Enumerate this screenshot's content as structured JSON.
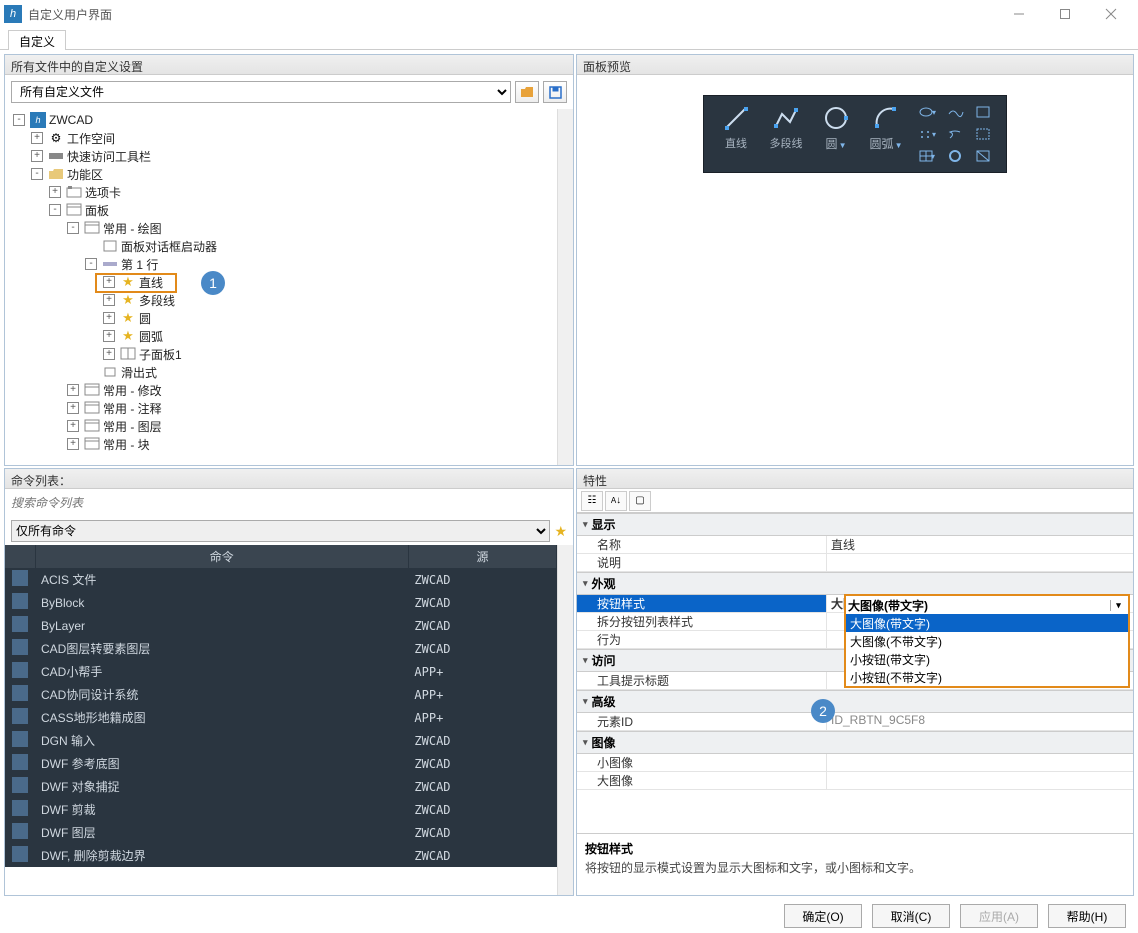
{
  "window": {
    "title": "自定义用户界面"
  },
  "tab": {
    "label": "自定义"
  },
  "panels": {
    "customize": {
      "header": "所有文件中的自定义设置",
      "filter_selected": "所有自定义文件"
    },
    "preview": {
      "header": "面板预览"
    },
    "commands": {
      "header": "命令列表：",
      "search_placeholder": "搜索命令列表",
      "filter_selected": "仅所有命令",
      "col_cmd": "命令",
      "col_src": "源"
    },
    "properties": {
      "header": "特性"
    }
  },
  "tree": [
    {
      "lvl": 0,
      "exp": "-",
      "icon": "app",
      "label": "ZWCAD"
    },
    {
      "lvl": 1,
      "exp": "+",
      "icon": "gear",
      "label": "工作空间"
    },
    {
      "lvl": 1,
      "exp": "+",
      "icon": "toolbar",
      "label": "快速访问工具栏"
    },
    {
      "lvl": 1,
      "exp": "-",
      "icon": "folder",
      "label": "功能区"
    },
    {
      "lvl": 2,
      "exp": "+",
      "icon": "tabs",
      "label": "选项卡"
    },
    {
      "lvl": 2,
      "exp": "-",
      "icon": "panel",
      "label": "面板"
    },
    {
      "lvl": 3,
      "exp": "-",
      "icon": "panel",
      "label": "常用 - 绘图"
    },
    {
      "lvl": 4,
      "exp": " ",
      "icon": "dialog",
      "label": "面板对话框启动器"
    },
    {
      "lvl": 4,
      "exp": "-",
      "icon": "row",
      "label": "第 1 行"
    },
    {
      "lvl": 5,
      "exp": "+",
      "icon": "star",
      "label": "直线",
      "hl": true
    },
    {
      "lvl": 5,
      "exp": "+",
      "icon": "star",
      "label": "多段线"
    },
    {
      "lvl": 5,
      "exp": "+",
      "icon": "star",
      "label": "圆"
    },
    {
      "lvl": 5,
      "exp": "+",
      "icon": "star",
      "label": "圆弧"
    },
    {
      "lvl": 5,
      "exp": "+",
      "icon": "sub",
      "label": "子面板1"
    },
    {
      "lvl": 4,
      "exp": " ",
      "icon": "slide",
      "label": "滑出式"
    },
    {
      "lvl": 3,
      "exp": "+",
      "icon": "panel",
      "label": "常用 - 修改"
    },
    {
      "lvl": 3,
      "exp": "+",
      "icon": "panel",
      "label": "常用 - 注释"
    },
    {
      "lvl": 3,
      "exp": "+",
      "icon": "panel",
      "label": "常用 - 图层"
    },
    {
      "lvl": 3,
      "exp": "+",
      "icon": "panel",
      "label": "常用 - 块"
    }
  ],
  "ribbon": {
    "big": [
      {
        "icon": "line",
        "label": "直线"
      },
      {
        "icon": "pline",
        "label": "多段线"
      },
      {
        "icon": "circle",
        "label": "圆"
      },
      {
        "icon": "arc",
        "label": "圆弧"
      }
    ]
  },
  "properties": {
    "groups": [
      {
        "name": "显示",
        "rows": [
          {
            "k": "名称",
            "v": "直线"
          },
          {
            "k": "说明",
            "v": ""
          }
        ]
      },
      {
        "name": "外观",
        "rows": [
          {
            "k": "按钮样式",
            "v": "大图像(带文字)",
            "selected": true
          },
          {
            "k": "拆分按钮列表样式",
            "v": ""
          },
          {
            "k": "行为",
            "v": ""
          }
        ]
      },
      {
        "name": "访问",
        "rows": [
          {
            "k": "工具提示标题",
            "v": ""
          }
        ]
      },
      {
        "name": "高级",
        "rows": [
          {
            "k": "元素ID",
            "v": "ID_RBTN_9C5F8",
            "readonly": true
          }
        ]
      },
      {
        "name": "图像",
        "rows": [
          {
            "k": "小图像",
            "v": ""
          },
          {
            "k": "大图像",
            "v": ""
          }
        ]
      }
    ],
    "dropdown": {
      "current": "大图像(带文字)",
      "options": [
        "大图像(带文字)",
        "大图像(不带文字)",
        "小按钮(带文字)",
        "小按钮(不带文字)"
      ]
    },
    "desc": {
      "title": "按钮样式",
      "text": "将按钮的显示模式设置为显示大图标和文字，或小图标和文字。"
    }
  },
  "commands_table": [
    {
      "icon": "acis",
      "name": "ACIS 文件",
      "src": "ZWCAD"
    },
    {
      "icon": "byblk",
      "name": "ByBlock",
      "src": "ZWCAD"
    },
    {
      "icon": "bylyr",
      "name": "ByLayer",
      "src": "ZWCAD"
    },
    {
      "icon": "layelem",
      "name": "CAD图层转要素图层",
      "src": "ZWCAD"
    },
    {
      "icon": "helper",
      "name": "CAD小帮手",
      "src": "APP+"
    },
    {
      "icon": "collab",
      "name": "CAD协同设计系统",
      "src": "APP+"
    },
    {
      "icon": "cass",
      "name": "CASS地形地籍成图",
      "src": "APP+"
    },
    {
      "icon": "dgn",
      "name": "DGN 输入",
      "src": "ZWCAD"
    },
    {
      "icon": "dwfref",
      "name": "DWF 参考底图",
      "src": "ZWCAD"
    },
    {
      "icon": "dwfsnap",
      "name": "DWF 对象捕捉",
      "src": "ZWCAD"
    },
    {
      "icon": "dwfclip",
      "name": "DWF 剪裁",
      "src": "ZWCAD"
    },
    {
      "icon": "dwflyr",
      "name": "DWF 图层",
      "src": "ZWCAD"
    },
    {
      "icon": "dwfdel",
      "name": "DWF, 删除剪裁边界",
      "src": "ZWCAD"
    }
  ],
  "buttons": {
    "ok": "确定(O)",
    "cancel": "取消(C)",
    "apply": "应用(A)",
    "help": "帮助(H)"
  },
  "callouts": {
    "one": "1",
    "two": "2"
  }
}
